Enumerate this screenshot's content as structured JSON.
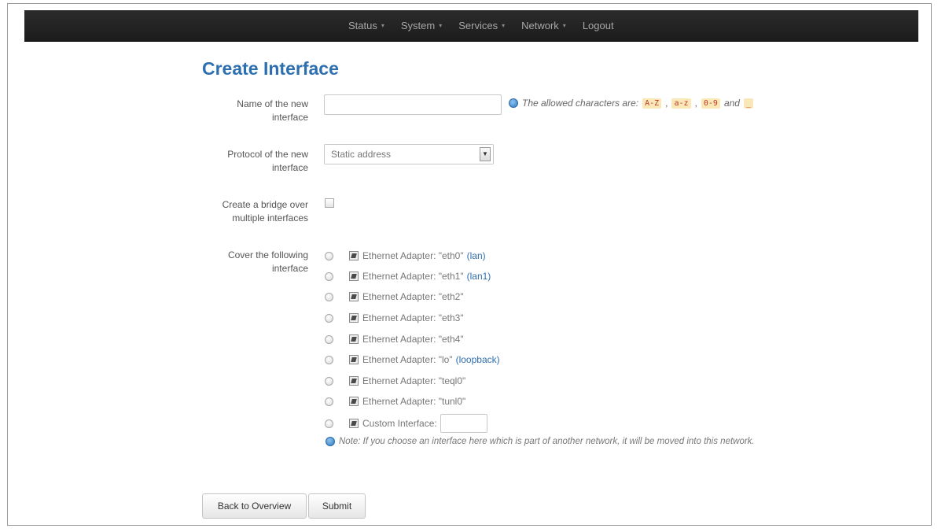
{
  "nav": {
    "items": [
      {
        "label": "Status",
        "caret": "▾"
      },
      {
        "label": "System",
        "caret": "▾"
      },
      {
        "label": "Services",
        "caret": "▾"
      },
      {
        "label": "Network",
        "caret": "▾"
      },
      {
        "label": "Logout",
        "caret": ""
      }
    ]
  },
  "page": {
    "title": "Create Interface"
  },
  "form": {
    "name_label": "Name of the new interface",
    "name_value": "",
    "hint": {
      "prefix": "The allowed characters are:",
      "codes": [
        "A-Z",
        "a-z",
        "0-9"
      ],
      "and": "and",
      "last_code": "_",
      "sep": ","
    },
    "protocol_label": "Protocol of the new interface",
    "protocol_selected": "Static address",
    "bridge_label": "Create a bridge over multiple interfaces",
    "bridge_checked": false,
    "cover_label": "Cover the following interface",
    "interfaces": [
      {
        "text": "Ethernet Adapter: \"eth0\"",
        "link": "(lan)"
      },
      {
        "text": "Ethernet Adapter: \"eth1\"",
        "link": "(lan1)"
      },
      {
        "text": "Ethernet Adapter: \"eth2\"",
        "link": ""
      },
      {
        "text": "Ethernet Adapter: \"eth3\"",
        "link": ""
      },
      {
        "text": "Ethernet Adapter: \"eth4\"",
        "link": ""
      },
      {
        "text": "Ethernet Adapter: \"lo\"",
        "link": "(loopback)"
      },
      {
        "text": "Ethernet Adapter: \"teql0\"",
        "link": ""
      },
      {
        "text": "Ethernet Adapter: \"tunl0\"",
        "link": ""
      }
    ],
    "custom_label": "Custom Interface:",
    "custom_value": "",
    "note": "Note: If you choose an interface here which is part of another network, it will be moved into this network."
  },
  "buttons": {
    "back": "Back to Overview",
    "submit": "Submit"
  },
  "colors": {
    "title": "#2e6fb0",
    "link": "#2e6fb0",
    "navbar": "#1f1f1f",
    "code_bg": "#fbe8b8"
  }
}
